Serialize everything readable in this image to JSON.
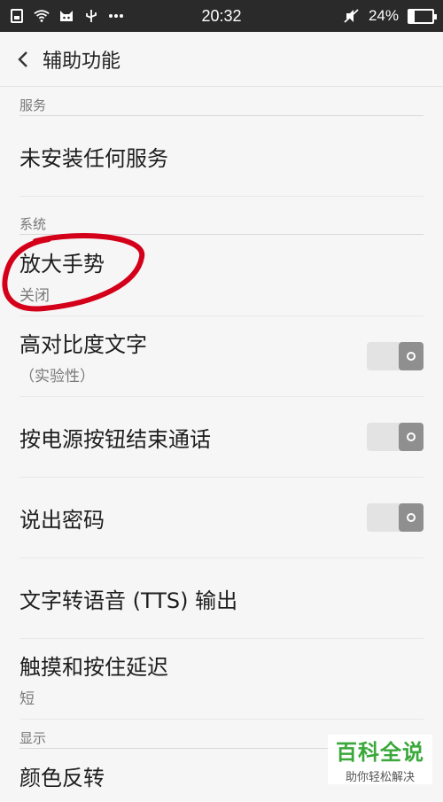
{
  "status_bar": {
    "time": "20:32",
    "battery": "24%",
    "battery_level": 0.24,
    "left_icons": [
      "sim-card-icon",
      "wifi-icon",
      "notification-app-icon",
      "usb-icon",
      "more-dots-icon"
    ],
    "right_icons": [
      "mute-icon",
      "battery-icon"
    ]
  },
  "header": {
    "title": "辅助功能"
  },
  "sections": {
    "services": {
      "label": "服务",
      "items": [
        {
          "title": "未安装任何服务"
        }
      ]
    },
    "system": {
      "label": "系统",
      "items": [
        {
          "title": "放大手势",
          "subtitle": "关闭"
        },
        {
          "title": "高对比度文字",
          "subtitle": "（实验性）",
          "toggle": false
        },
        {
          "title": "按电源按钮结束通话",
          "toggle": false
        },
        {
          "title": "说出密码",
          "toggle": false
        },
        {
          "title": "文字转语音 (TTS) 输出"
        },
        {
          "title": "触摸和按住延迟",
          "subtitle": "短"
        }
      ]
    },
    "display": {
      "label": "显示",
      "items": [
        {
          "title": "颜色反转"
        }
      ]
    }
  },
  "watermark": {
    "main": "百科全说",
    "sub": "助你轻松解决"
  },
  "colors": {
    "status_bar": "#2a2a2a",
    "annotation": "#d4001a",
    "watermark": "#3aa83a"
  }
}
